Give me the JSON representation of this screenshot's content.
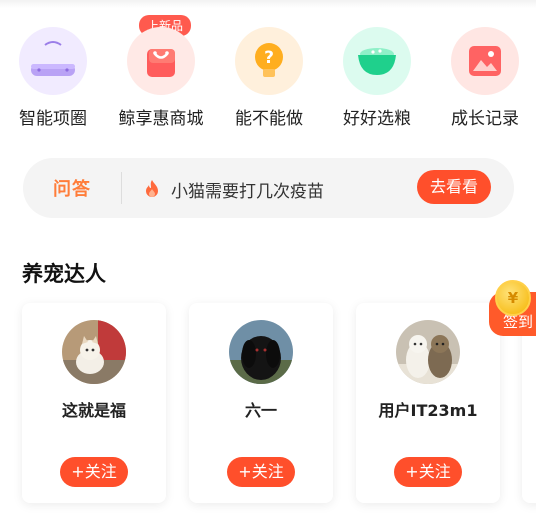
{
  "quick_menu": [
    {
      "label": "智能项圈",
      "icon": "collar-icon"
    },
    {
      "label": "鲸享惠商城",
      "icon": "shopping-bag-icon",
      "badge": "上新品"
    },
    {
      "label": "能不能做",
      "icon": "lightbulb-question-icon"
    },
    {
      "label": "好好选粮",
      "icon": "pet-bowl-icon"
    },
    {
      "label": "成长记录",
      "icon": "photo-icon"
    }
  ],
  "qa_bar": {
    "logo": "问答",
    "question": "小猫需要打几次疫苗",
    "button": "去看看",
    "icon": "fire-icon"
  },
  "section": {
    "title": "养宠达人"
  },
  "sign_in": {
    "label": "签到",
    "coin": "¥"
  },
  "experts": [
    {
      "name": "这就是福",
      "follow": "+关注"
    },
    {
      "name": "六一",
      "follow": "+关注"
    },
    {
      "name": "用户IT23m1",
      "follow": "+关注"
    }
  ],
  "colors": {
    "accent": "#ff4f2b",
    "logo_orange": "#ff7d3a"
  }
}
